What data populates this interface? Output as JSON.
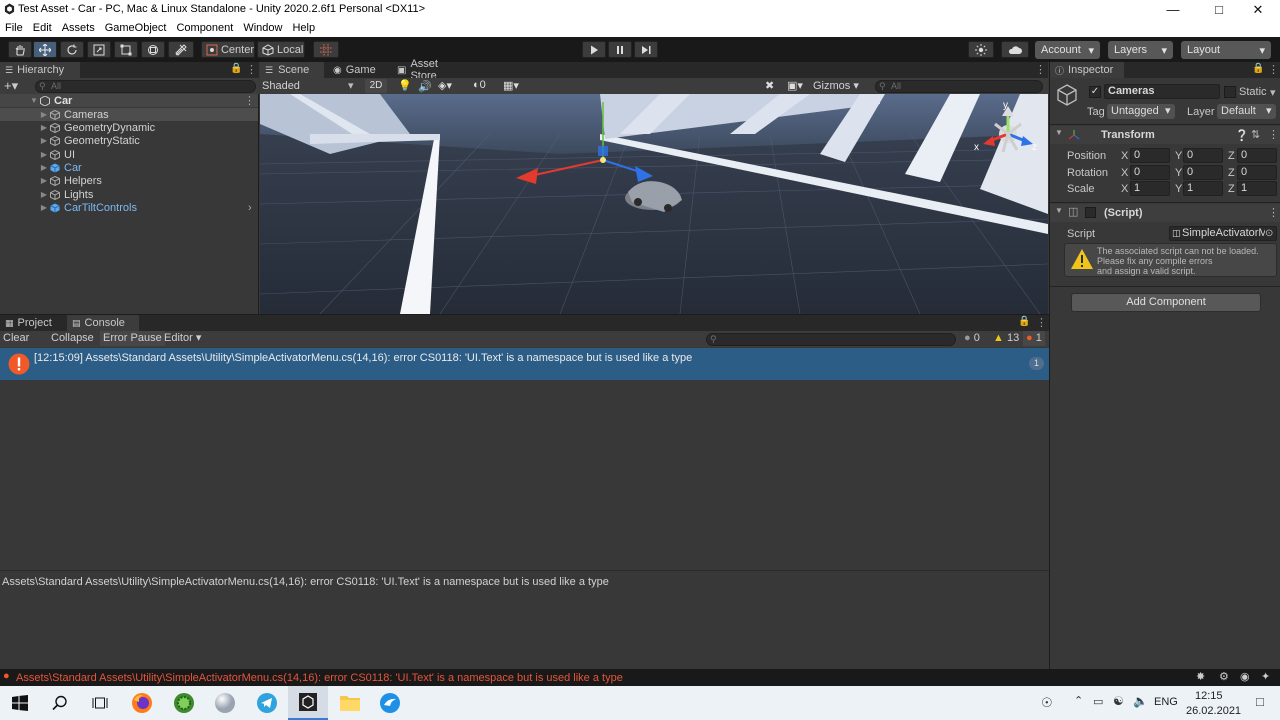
{
  "window": {
    "title": "Test Asset - Car - PC, Mac & Linux Standalone - Unity 2020.2.6f1 Personal <DX11>"
  },
  "menu": [
    "File",
    "Edit",
    "Assets",
    "GameObject",
    "Component",
    "Window",
    "Help"
  ],
  "toolbar": {
    "pivot": "Center",
    "space": "Local",
    "account": "Account",
    "layers": "Layers",
    "layout": "Layout"
  },
  "hierarchy": {
    "tab": "Hierarchy",
    "search_placeholder": "All",
    "root": "Car",
    "items": [
      {
        "label": "Cameras",
        "prefab": false,
        "selected": true
      },
      {
        "label": "GeometryDynamic",
        "prefab": false
      },
      {
        "label": "GeometryStatic",
        "prefab": false
      },
      {
        "label": "UI",
        "prefab": false
      },
      {
        "label": "Car",
        "prefab": true
      },
      {
        "label": "Helpers",
        "prefab": false
      },
      {
        "label": "Lights",
        "prefab": false
      },
      {
        "label": "CarTiltControls",
        "prefab": true
      }
    ]
  },
  "scene": {
    "tabs": [
      "Scene",
      "Game",
      "Asset Store"
    ],
    "shading": "Shaded",
    "mode_2d": "2D",
    "hidden_count": "0",
    "gizmos": "Gizmos",
    "search_placeholder": "All",
    "projection": "<Persp",
    "axis_x": "x",
    "axis_y": "y",
    "axis_z": "z"
  },
  "console": {
    "tabs": [
      "Project",
      "Console"
    ],
    "buttons": [
      "Clear",
      "Collapse",
      "Error Pause",
      "Editor"
    ],
    "counts": {
      "info": "0",
      "warnings": "13",
      "errors": "1"
    },
    "entry_text": "[12:15:09] Assets\\Standard Assets\\Utility\\SimpleActivatorMenu.cs(14,16): error CS0118: 'UI.Text' is a namespace but is used like a type",
    "entry_count": "1",
    "detail_text": "Assets\\Standard Assets\\Utility\\SimpleActivatorMenu.cs(14,16): error CS0118: 'UI.Text' is a namespace but is used like a type"
  },
  "inspector": {
    "tab": "Inspector",
    "object_name": "Cameras",
    "static_label": "Static",
    "tag_label": "Tag",
    "tag_value": "Untagged",
    "layer_label": "Layer",
    "layer_value": "Default",
    "transform_title": "Transform",
    "rows": [
      {
        "label": "Position",
        "x": "0",
        "y": "0",
        "z": "0"
      },
      {
        "label": "Rotation",
        "x": "0",
        "y": "0",
        "z": "0"
      },
      {
        "label": "Scale",
        "x": "1",
        "y": "1",
        "z": "1"
      }
    ],
    "axis_labels": [
      "X",
      "Y",
      "Z"
    ],
    "script_component_title": "(Script)",
    "script_label": "Script",
    "script_value": "SimpleActivatorM",
    "warning_lines": [
      "The associated script can not be loaded.",
      "Please fix any compile errors",
      "and assign a valid script."
    ],
    "add_component": "Add Component"
  },
  "statusbar": {
    "error_text": "Assets\\Standard Assets\\Utility\\SimpleActivatorMenu.cs(14,16): error CS0118: 'UI.Text' is a namespace but is used like a type"
  },
  "taskbar": {
    "language": "ENG",
    "time": "12:15",
    "date": "26.02.2021"
  },
  "colors": {
    "accent": "#2c5d87",
    "error": "#f05a28",
    "warning": "#f0c419",
    "prefab": "#7ab9f3"
  }
}
